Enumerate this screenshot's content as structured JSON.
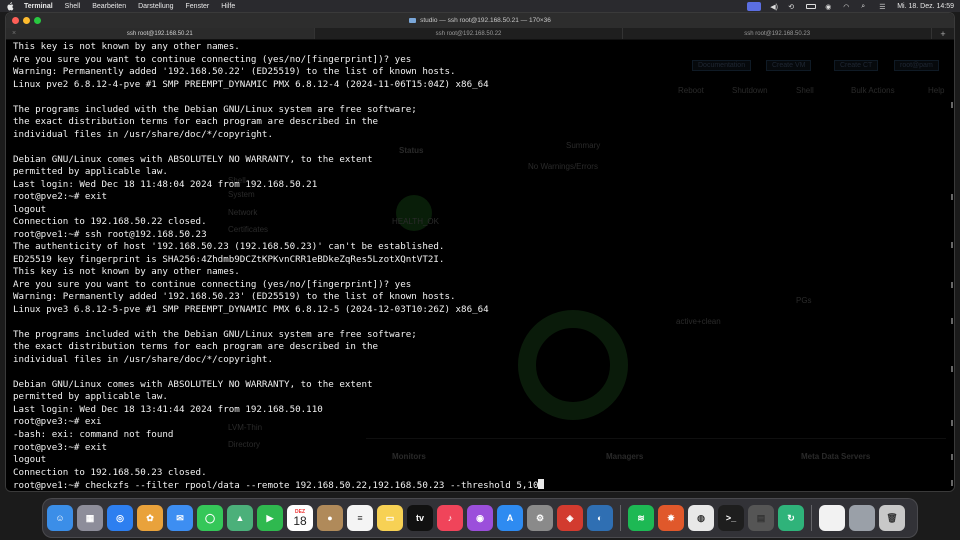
{
  "menubar": {
    "items": [
      "Terminal",
      "Shell",
      "Bearbeiten",
      "Darstellung",
      "Fenster",
      "Hilfe"
    ],
    "clock": "Mi. 18. Dez.  14:59"
  },
  "window": {
    "title": "studio — ssh root@192.168.50.21 — 170×36",
    "tabs": [
      {
        "label": "ssh root@192.168.50.21",
        "active": true
      },
      {
        "label": "ssh root@192.168.50.22",
        "active": false
      },
      {
        "label": "ssh root@192.168.50.23",
        "active": false
      }
    ],
    "add_tab": "+"
  },
  "terminal": {
    "lines": [
      "This key is not known by any other names.",
      "Are you sure you want to continue connecting (yes/no/[fingerprint])? yes",
      "Warning: Permanently added '192.168.50.22' (ED25519) to the list of known hosts.",
      "Linux pve2 6.8.12-4-pve #1 SMP PREEMPT_DYNAMIC PMX 6.8.12-4 (2024-11-06T15:04Z) x86_64",
      "",
      "The programs included with the Debian GNU/Linux system are free software;",
      "the exact distribution terms for each program are described in the",
      "individual files in /usr/share/doc/*/copyright.",
      "",
      "Debian GNU/Linux comes with ABSOLUTELY NO WARRANTY, to the extent",
      "permitted by applicable law.",
      "Last login: Wed Dec 18 11:48:04 2024 from 192.168.50.21",
      "root@pve2:~# exit",
      "logout",
      "Connection to 192.168.50.22 closed.",
      "root@pve1:~# ssh root@192.168.50.23",
      "The authenticity of host '192.168.50.23 (192.168.50.23)' can't be established.",
      "ED25519 key fingerprint is SHA256:4Zhdmb9DCZtKPKvnCRR1eBDkeZqRes5LzotXQntVT2I.",
      "This key is not known by any other names.",
      "Are you sure you want to continue connecting (yes/no/[fingerprint])? yes",
      "Warning: Permanently added '192.168.50.23' (ED25519) to the list of known hosts.",
      "Linux pve3 6.8.12-5-pve #1 SMP PREEMPT_DYNAMIC PMX 6.8.12-5 (2024-12-03T10:26Z) x86_64",
      "",
      "The programs included with the Debian GNU/Linux system are free software;",
      "the exact distribution terms for each program are described in the",
      "individual files in /usr/share/doc/*/copyright.",
      "",
      "Debian GNU/Linux comes with ABSOLUTELY NO WARRANTY, to the extent",
      "permitted by applicable law.",
      "Last login: Wed Dec 18 13:41:44 2024 from 192.168.50.110",
      "root@pve3:~# exi",
      "-bash: exi: command not found",
      "root@pve3:~# exit",
      "logout",
      "Connection to 192.168.50.23 closed."
    ],
    "prompt_line": "root@pve1:~# checkzfs --filter rpool/data --remote 192.168.50.22,192.168.50.23 --threshold 5,10"
  },
  "background_ghost": {
    "status": "Status",
    "summary": "Summary",
    "no_warnings": "No Warnings/Errors",
    "health": "HEALTH_OK",
    "pgs": "PGs",
    "active_clean": "active+clean",
    "monitors": "Monitors",
    "managers": "Managers",
    "meta_data_servers": "Meta Data Servers",
    "buttons": [
      "Documentation",
      "Create VM",
      "Create CT",
      "root@pam"
    ],
    "actions": [
      "Reboot",
      "Shutdown",
      "Shell",
      "Bulk Actions",
      "Help"
    ],
    "tree": [
      "Summary",
      "Notes",
      "Shell",
      "System",
      "Network",
      "Certificates",
      "Directory",
      "LVM-Thin"
    ]
  },
  "dock": {
    "calendar_month": "DEZ",
    "calendar_day": "18",
    "apps": [
      {
        "name": "finder",
        "color": "#3b8ee8",
        "glyph": "☺"
      },
      {
        "name": "launchpad",
        "color": "#8d8d9a",
        "glyph": "▦"
      },
      {
        "name": "safari",
        "color": "#2d7ff0",
        "glyph": "◎"
      },
      {
        "name": "photos",
        "color": "#e9a23b",
        "glyph": "✿"
      },
      {
        "name": "mail",
        "color": "#3d8ef2",
        "glyph": "✉"
      },
      {
        "name": "messages",
        "color": "#35c759",
        "glyph": "◯"
      },
      {
        "name": "maps",
        "color": "#4bb07a",
        "glyph": "▲"
      },
      {
        "name": "facetime",
        "color": "#2fb94f",
        "glyph": "▶"
      },
      {
        "name": "calendar",
        "color": "#ffffff",
        "glyph": ""
      },
      {
        "name": "contacts",
        "color": "#b08a5a",
        "glyph": "●"
      },
      {
        "name": "reminders",
        "color": "#f4f4f4",
        "glyph": "≡"
      },
      {
        "name": "notes",
        "color": "#f7d154",
        "glyph": "▭"
      },
      {
        "name": "tv",
        "color": "#111111",
        "glyph": "tv"
      },
      {
        "name": "music",
        "color": "#f0445a",
        "glyph": "♪"
      },
      {
        "name": "podcasts",
        "color": "#9b4fdb",
        "glyph": "◉"
      },
      {
        "name": "app-store",
        "color": "#2e8bf1",
        "glyph": "A"
      },
      {
        "name": "system-settings",
        "color": "#8a8a8a",
        "glyph": "⚙"
      },
      {
        "name": "app-red",
        "color": "#d23b2f",
        "glyph": "◈"
      },
      {
        "name": "app-blue",
        "color": "#2f6fb3",
        "glyph": "◐"
      },
      {
        "name": "spotify",
        "color": "#1db954",
        "glyph": "≋"
      },
      {
        "name": "app-orange",
        "color": "#e0582b",
        "glyph": "✸"
      },
      {
        "name": "chrome",
        "color": "#e8e8e8",
        "glyph": "◍"
      },
      {
        "name": "terminal",
        "color": "#1e1e1e",
        "glyph": ">_"
      },
      {
        "name": "calculator",
        "color": "#555555",
        "glyph": "▤"
      },
      {
        "name": "app-green",
        "color": "#2fb37a",
        "glyph": "↻"
      },
      {
        "name": "document",
        "color": "#f2f2f2",
        "glyph": ""
      },
      {
        "name": "downloads",
        "color": "#9aa0a8",
        "glyph": ""
      },
      {
        "name": "trash",
        "color": "#c8c8c8",
        "glyph": "🗑"
      }
    ]
  }
}
